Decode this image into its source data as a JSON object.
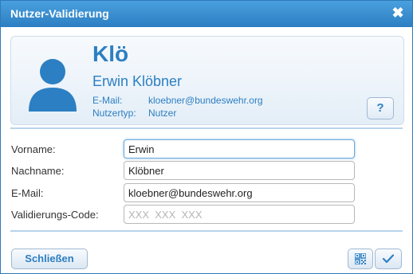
{
  "window": {
    "title": "Nutzer-Validierung"
  },
  "profile": {
    "username": "Klö",
    "full_name": "Erwin Klöbner",
    "email_label": "E-Mail:",
    "email_value": "kloebner@bundeswehr.org",
    "type_label": "Nutzertyp:",
    "type_value": "Nutzer",
    "help_label": "?"
  },
  "form": {
    "firstname": {
      "label": "Vorname:",
      "value": "Erwin"
    },
    "lastname": {
      "label": "Nachname:",
      "value": "Klöbner"
    },
    "email": {
      "label": "E-Mail:",
      "value": "kloebner@bundeswehr.org"
    },
    "code": {
      "label": "Validierungs-Code:",
      "value": "",
      "placeholder": "XXX  XXX  XXX"
    }
  },
  "footer": {
    "close_label": "Schließen",
    "qr_icon": "qr-code-icon",
    "confirm_icon": "checkmark-icon"
  },
  "colors": {
    "accent": "#2c7fc2",
    "titlebar": "#3a8ed0"
  }
}
